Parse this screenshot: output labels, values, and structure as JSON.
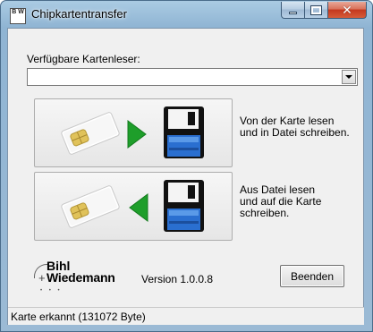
{
  "window": {
    "title": "Chipkartentransfer",
    "app_icon_text": "B W"
  },
  "readers": {
    "label": "Verfügbare Kartenleser:",
    "selected": ""
  },
  "read_action": {
    "line1": "Von der Karte lesen",
    "line2": "und in Datei schreiben."
  },
  "write_action": {
    "line1": "Aus Datei lesen",
    "line2": "und auf die Karte",
    "line3": "schreiben."
  },
  "logo": {
    "line1": "Bihl",
    "line2": "Wiedemann"
  },
  "version": "Version 1.0.0.8",
  "close_button": "Beenden",
  "status": "Karte erkannt (131072 Byte)",
  "colors": {
    "arrow_green": "#1e9e2a",
    "disk_blue": "#2a6fd0"
  }
}
